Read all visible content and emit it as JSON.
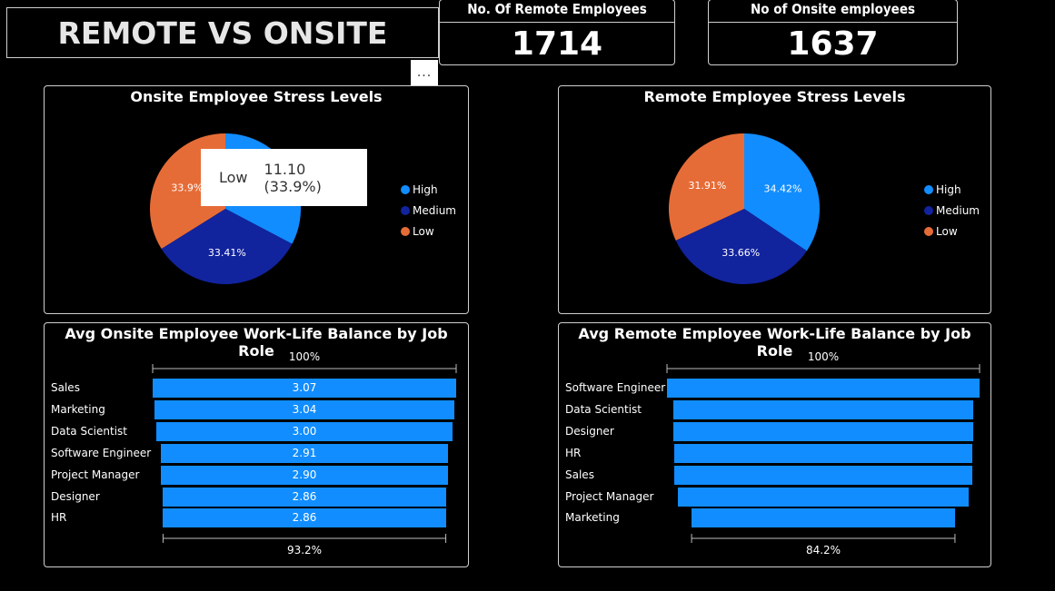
{
  "header": {
    "title": "REMOTE VS ONSITE"
  },
  "kpis": {
    "remote_label": "No. Of Remote Employees",
    "remote_value": "1714",
    "onsite_label": "No of Onsite employees",
    "onsite_value": "1637"
  },
  "more_options": "...",
  "tooltip": {
    "key": "Low",
    "value": "11.10 (33.9%)"
  },
  "colors": {
    "high": "#118DFF",
    "medium": "#12239E",
    "low": "#E66C37",
    "bar": "#118DFF",
    "background": "#000000",
    "border": "#CFCFCF"
  },
  "legend": [
    "High",
    "Medium",
    "Low"
  ],
  "chart_data": [
    {
      "type": "pie",
      "title": "Onsite Employee Stress Levels",
      "slices": [
        {
          "label": "High",
          "value": 32.7
        },
        {
          "label": "Medium",
          "value": 33.41
        },
        {
          "label": "Low",
          "value": 33.9
        }
      ],
      "data_labels": [
        "33.41%",
        "33.9%"
      ]
    },
    {
      "type": "pie",
      "title": "Remote Employee Stress Levels",
      "slices": [
        {
          "label": "High",
          "value": 34.42
        },
        {
          "label": "Medium",
          "value": 33.66
        },
        {
          "label": "Low",
          "value": 31.91
        }
      ],
      "data_labels": [
        "34.42%",
        "33.66%",
        "31.91%"
      ]
    },
    {
      "type": "bar",
      "subtype": "funnel",
      "title": "Avg Onsite Employee Work-Life Balance by Job Role",
      "categories": [
        "Sales",
        "Marketing",
        "Data Scientist",
        "Software Engineer",
        "Project Manager",
        "Designer",
        "HR"
      ],
      "values": [
        3.07,
        3.04,
        3.0,
        2.91,
        2.9,
        2.86,
        2.86
      ],
      "data_labels": [
        "3.07",
        "3.04",
        "3.00",
        "2.91",
        "2.90",
        "2.86",
        "2.86"
      ],
      "top_label": "100%",
      "bottom_label": "93.2%"
    },
    {
      "type": "bar",
      "subtype": "funnel",
      "title": "Avg Remote Employee Work-Life Balance by Job Role",
      "categories": [
        "Software Engineer",
        "Data Scientist",
        "Designer",
        "HR",
        "Sales",
        "Project Manager",
        "Marketing"
      ],
      "values": [
        3.05,
        2.93,
        2.92,
        2.91,
        2.9,
        2.84,
        2.57
      ],
      "top_label": "100%",
      "bottom_label": "84.2%"
    }
  ]
}
